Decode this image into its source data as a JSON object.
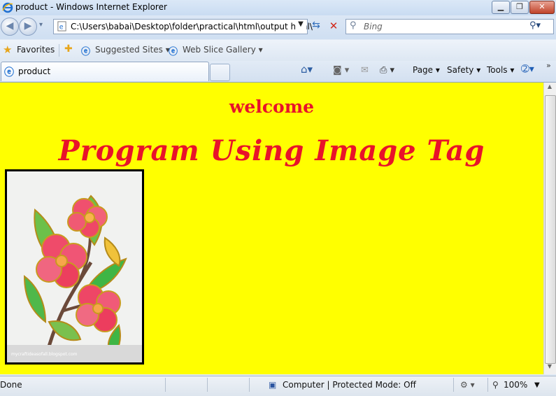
{
  "window": {
    "title": "product - Windows Internet Explorer"
  },
  "address_bar": {
    "url": "C:\\Users\\babai\\Desktop\\folder\\practical\\html\\output html\\"
  },
  "search": {
    "placeholder": "Bing"
  },
  "favorites_bar": {
    "favorites_label": "Favorites",
    "items": [
      {
        "label": "Suggested Sites ▾"
      },
      {
        "label": "Web Slice Gallery ▾"
      }
    ]
  },
  "tab": {
    "label": "product"
  },
  "command_bar": {
    "page": "Page ▾",
    "safety": "Safety ▾",
    "tools": "Tools ▾"
  },
  "page": {
    "welcome": "welcome",
    "heading": "Program Using Image Tag",
    "image_credit": "mycraftideasofall.blogspot.com"
  },
  "status_bar": {
    "status": "Done",
    "zone": "Computer | Protected Mode: Off",
    "zoom": "100%"
  },
  "colors": {
    "page_background": "#ffff00",
    "page_text": "#e8132a"
  }
}
